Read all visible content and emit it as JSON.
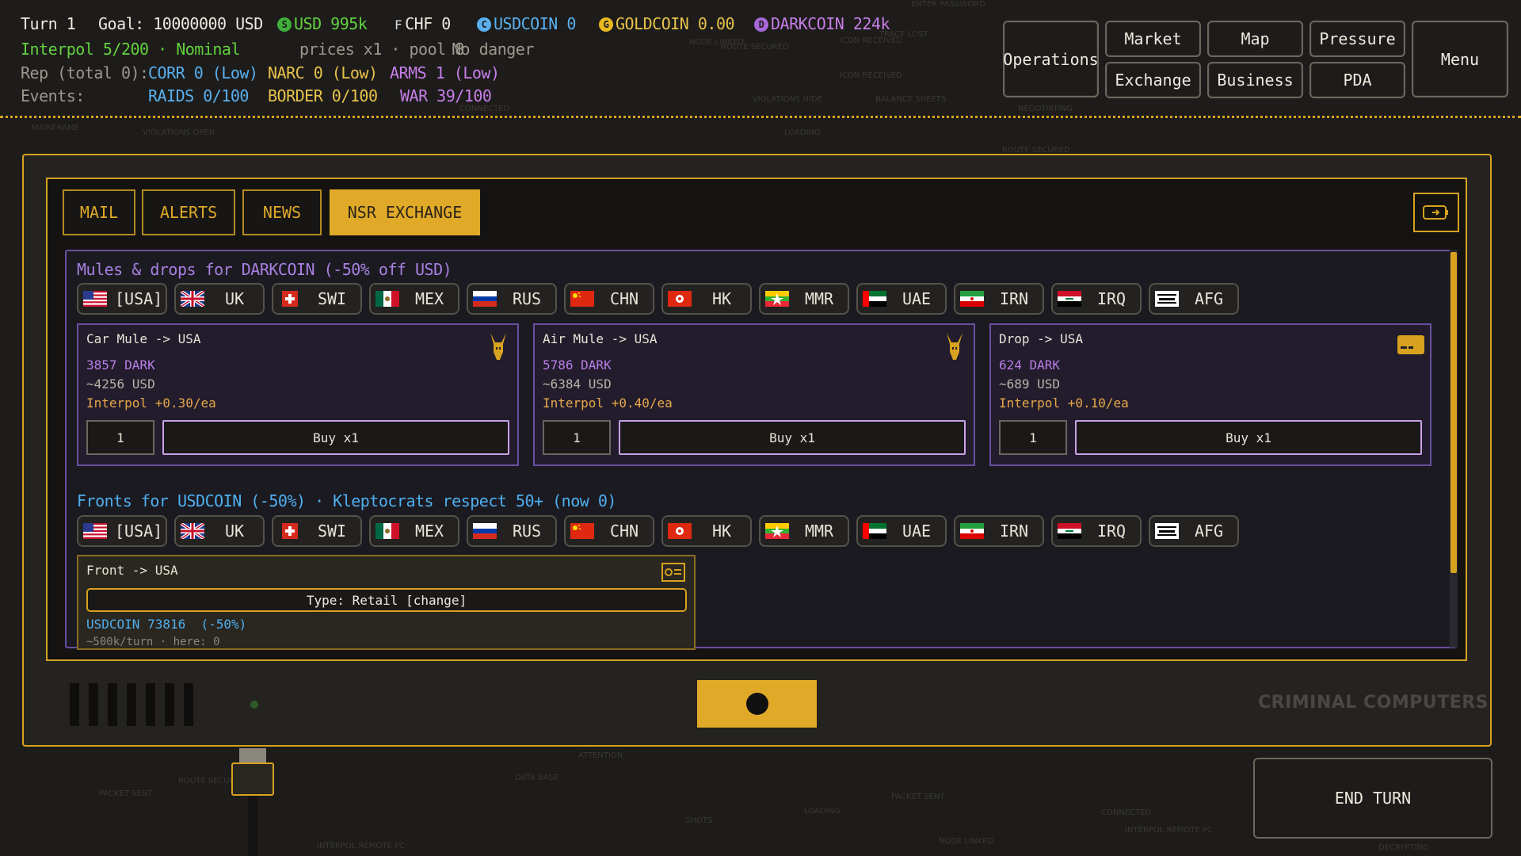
{
  "status": {
    "turn": "Turn 1",
    "goal": "Goal: 10000000 USD",
    "usd": "USD 995k",
    "chf": "CHF 0",
    "usdcoin": "USDCOIN 0",
    "goldcoin": "GOLDCOIN 0.00",
    "darkcoin": "DARKCOIN 224k",
    "interpol": "Interpol 5/200 · Nominal",
    "prices": "prices x1 · pool 8",
    "danger": "No danger",
    "rep_label": "Rep (total 0):",
    "corr": "CORR 0 (Low)",
    "narc": "NARC 0 (Low)",
    "arms": "ARMS 1 (Low)",
    "events_label": "Events:",
    "raids": "RAIDS 0/100",
    "border": "BORDER 0/100",
    "war": "WAR 39/100"
  },
  "coin_icons": {
    "usd": "S",
    "chf": "F",
    "usdcoin": "C",
    "goldcoin": "G",
    "darkcoin": "D"
  },
  "nav": {
    "operations": "Operations",
    "market": "Market",
    "map": "Map",
    "pressure": "Pressure",
    "menu": "Menu",
    "exchange": "Exchange",
    "business": "Business",
    "pda": "PDA"
  },
  "tabs": [
    "MAIL",
    "ALERTS",
    "NEWS",
    "NSR EXCHANGE"
  ],
  "mules": {
    "title": "Mules & drops for DARKCOIN (-50% off USD)",
    "countries": [
      "[USA]",
      "UK",
      "SWI",
      "MEX",
      "RUS",
      "CHN",
      "HK",
      "MMR",
      "UAE",
      "IRN",
      "IRQ",
      "AFG"
    ],
    "cards": [
      {
        "title": "Car Mule -> USA",
        "dark": "3857 DARK",
        "usd": "~4256 USD",
        "interpol": "Interpol +0.30/ea",
        "qty": "1",
        "buy": "Buy x1",
        "icon": "donkey-icon"
      },
      {
        "title": "Air Mule -> USA",
        "dark": "5786 DARK",
        "usd": "~6384 USD",
        "interpol": "Interpol +0.40/ea",
        "qty": "1",
        "buy": "Buy x1",
        "icon": "donkey-icon"
      },
      {
        "title": "Drop -> USA",
        "dark": "624 DARK",
        "usd": "~689 USD",
        "interpol": "Interpol +0.10/ea",
        "qty": "1",
        "buy": "Buy x1",
        "icon": "card-icon"
      }
    ]
  },
  "fronts": {
    "title": "Fronts for USDCOIN (-50%) · Kleptocrats respect 50+ (now 0)",
    "countries": [
      "[USA]",
      "UK",
      "SWI",
      "MEX",
      "RUS",
      "CHN",
      "HK",
      "MMR",
      "UAE",
      "IRN",
      "IRQ",
      "AFG"
    ],
    "card": {
      "title": "Front -> USA",
      "type_button": "Type: Retail [change]",
      "price": "USDCOIN 73816  (-50%)",
      "sub": "~500k/turn · here: 0"
    }
  },
  "brand": "CRIMINAL COMPUTERS",
  "end_turn": "END TURN",
  "colors": {
    "accent": "#d6a21f",
    "purple": "#6a4fa0",
    "green": "#63d13f",
    "blue": "#5ab0f0"
  }
}
